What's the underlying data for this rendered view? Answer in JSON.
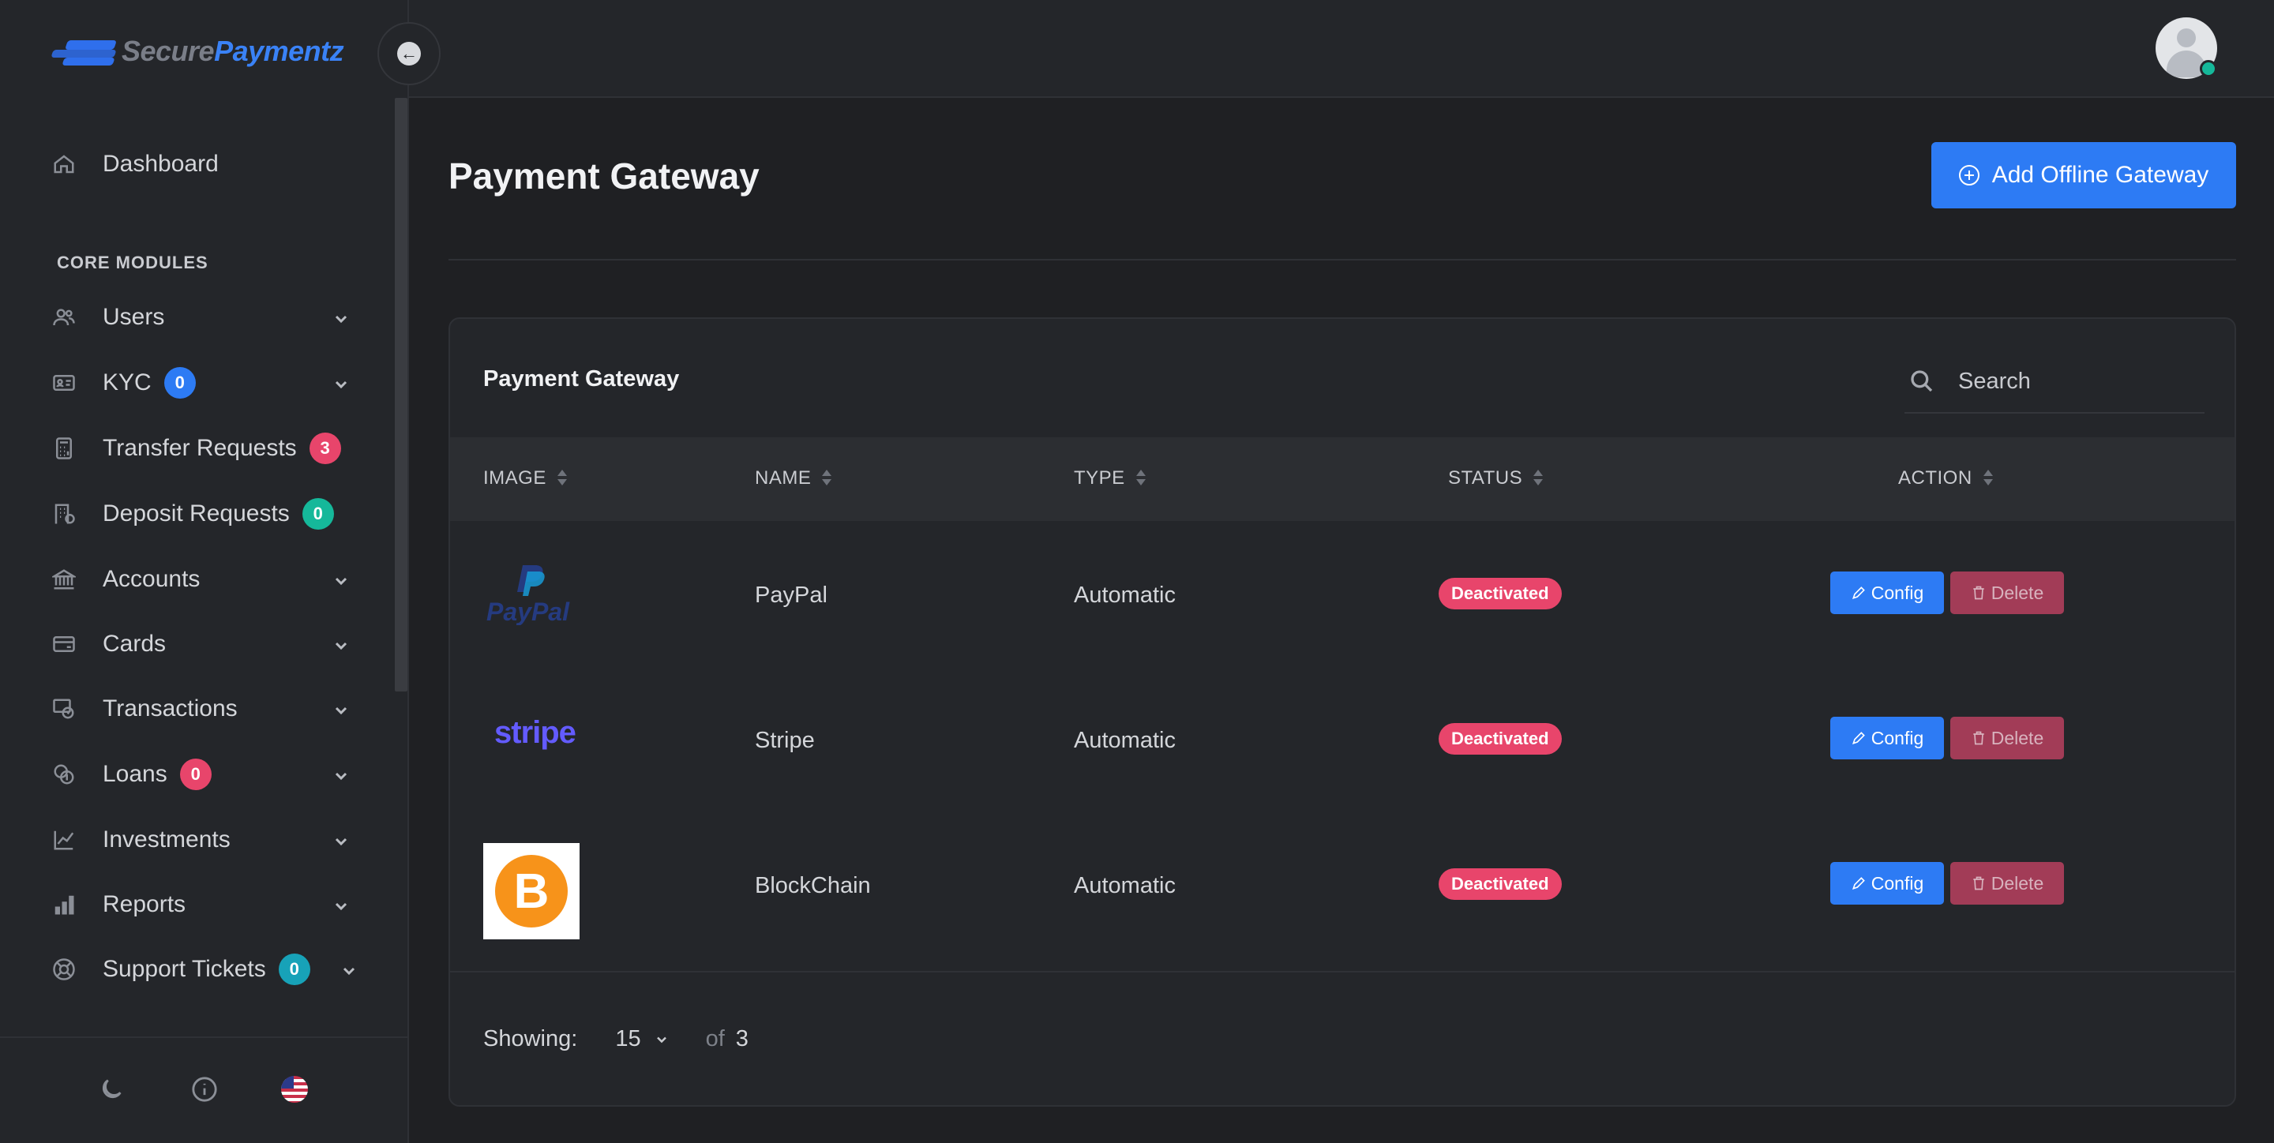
{
  "brand": {
    "name_part1": "Secure",
    "name_part2": "Paymentz",
    "accent": "#2d7bf4"
  },
  "sidebar": {
    "section_title": "CORE MODULES",
    "items": [
      {
        "label": "Dashboard",
        "icon": "home-icon"
      },
      {
        "label": "Users",
        "icon": "users-icon",
        "has_submenu": true
      },
      {
        "label": "KYC",
        "icon": "id-card-icon",
        "badge": "0",
        "badge_color": "#2d7bf4",
        "has_submenu": true
      },
      {
        "label": "Transfer Requests",
        "icon": "calculator-icon",
        "badge": "3",
        "badge_color": "#e8456b"
      },
      {
        "label": "Deposit Requests",
        "icon": "building-icon",
        "badge": "0",
        "badge_color": "#15b89a"
      },
      {
        "label": "Accounts",
        "icon": "bank-icon",
        "has_submenu": true
      },
      {
        "label": "Cards",
        "icon": "credit-card-icon",
        "has_submenu": true
      },
      {
        "label": "Transactions",
        "icon": "transactions-icon",
        "has_submenu": true
      },
      {
        "label": "Loans",
        "icon": "coins-icon",
        "badge": "0",
        "badge_color": "#e8456b",
        "has_submenu": true
      },
      {
        "label": "Investments",
        "icon": "chart-line-icon",
        "has_submenu": true
      },
      {
        "label": "Reports",
        "icon": "bar-chart-icon",
        "has_submenu": true
      },
      {
        "label": "Support Tickets",
        "icon": "lifebuoy-icon",
        "badge": "0",
        "badge_color": "#17a2b8",
        "has_submenu": true
      }
    ],
    "footer_icons": [
      "moon-icon",
      "info-icon",
      "us-flag-icon"
    ]
  },
  "main": {
    "page_title": "Payment Gateway",
    "add_button_label": "Add Offline Gateway",
    "card_title": "Payment Gateway",
    "search_placeholder": "Search",
    "columns": [
      "IMAGE",
      "NAME",
      "TYPE",
      "STATUS",
      "ACTION"
    ],
    "rows": [
      {
        "image": "paypal-logo",
        "logo_text": "PayPal",
        "name": "PayPal",
        "type": "Automatic",
        "status": "Deactivated",
        "config_label": "Config",
        "delete_label": "Delete"
      },
      {
        "image": "stripe-logo",
        "logo_text": "stripe",
        "name": "Stripe",
        "type": "Automatic",
        "status": "Deactivated",
        "config_label": "Config",
        "delete_label": "Delete"
      },
      {
        "image": "bitcoin-logo",
        "logo_text": "B",
        "name": "BlockChain",
        "type": "Automatic",
        "status": "Deactivated",
        "config_label": "Config",
        "delete_label": "Delete"
      }
    ],
    "pagination": {
      "showing_label": "Showing:",
      "per_page": "15",
      "of_label": "of",
      "total": "3"
    }
  }
}
